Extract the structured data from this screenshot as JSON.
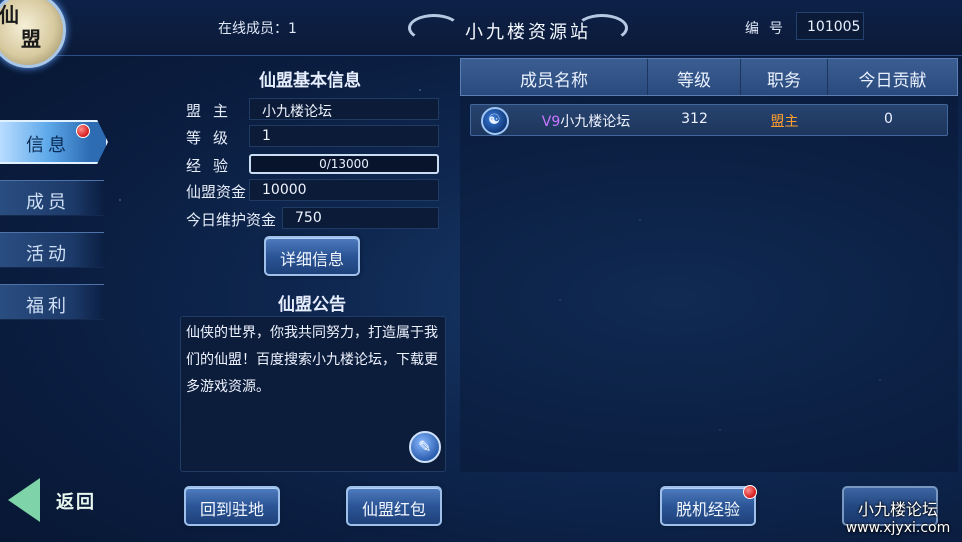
{
  "header": {
    "online_members_label": "在线成员：1",
    "title": "小九楼资源站",
    "id_label": "编号",
    "id_value": "101005"
  },
  "emblem": {
    "line1": "仙",
    "line2": "盟"
  },
  "sidebar": {
    "items": [
      {
        "label": "信息",
        "active": true,
        "badge": true
      },
      {
        "label": "成员",
        "active": false,
        "badge": false
      },
      {
        "label": "活动",
        "active": false,
        "badge": false
      },
      {
        "label": "福利",
        "active": false,
        "badge": false
      }
    ],
    "back_label": "返回"
  },
  "basic_info": {
    "title": "仙盟基本信息",
    "leader_label": "盟主",
    "leader_value": "小九楼论坛",
    "level_label": "等级",
    "level_value": "1",
    "exp_label": "经验",
    "exp_text": "0/13000",
    "exp_fraction": 0,
    "funds_label": "仙盟资金",
    "funds_value": "10000",
    "upkeep_label": "今日维护资金",
    "upkeep_value": "750",
    "details_button": "详细信息"
  },
  "notice": {
    "title": "仙盟公告",
    "text": "仙侠的世界，你我共同努力，打造属于我们的仙盟！百度搜索小九楼论坛，下载更多游戏资源。",
    "edit_icon": "edit-icon"
  },
  "members_table": {
    "columns": [
      "成员名称",
      "等级",
      "职务",
      "今日贡献"
    ],
    "rows": [
      {
        "vip": "V9",
        "name": "小九楼论坛",
        "level": "312",
        "role": "盟主",
        "contribution": "0"
      }
    ]
  },
  "bottom_buttons": {
    "return_base": "回到驻地",
    "red_packet": "仙盟红包",
    "offline_exp": "脱机经验"
  },
  "watermark": {
    "name": "小九楼论坛",
    "url": "www.xjyxi.com"
  },
  "colors": {
    "vip": "#c978ff",
    "role": "#ff9f2e",
    "badge": "#d51a1a",
    "accent": "#3c78c8"
  }
}
